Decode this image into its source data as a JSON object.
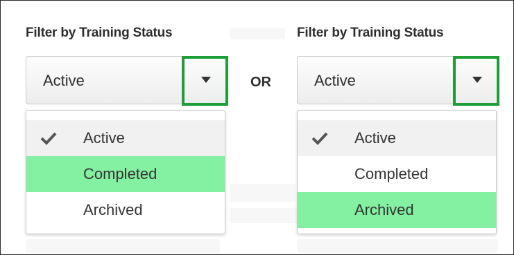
{
  "colors": {
    "highlight": "#84f0a1",
    "callout_border": "#1e9e37",
    "checked_row": "#f1f1f1"
  },
  "separator_text": "OR",
  "panels": [
    {
      "title": "Filter by Training Status",
      "selected_value": "Active",
      "options": [
        {
          "label": "Active",
          "checked": true,
          "highlighted": false
        },
        {
          "label": "Completed",
          "checked": false,
          "highlighted": true
        },
        {
          "label": "Archived",
          "checked": false,
          "highlighted": false
        }
      ]
    },
    {
      "title": "Filter by Training Status",
      "selected_value": "Active",
      "options": [
        {
          "label": "Active",
          "checked": true,
          "highlighted": false
        },
        {
          "label": "Completed",
          "checked": false,
          "highlighted": false
        },
        {
          "label": "Archived",
          "checked": false,
          "highlighted": true
        }
      ]
    }
  ],
  "icons": {
    "dropdown": "caret-down-icon",
    "selected": "checkmark-icon"
  }
}
